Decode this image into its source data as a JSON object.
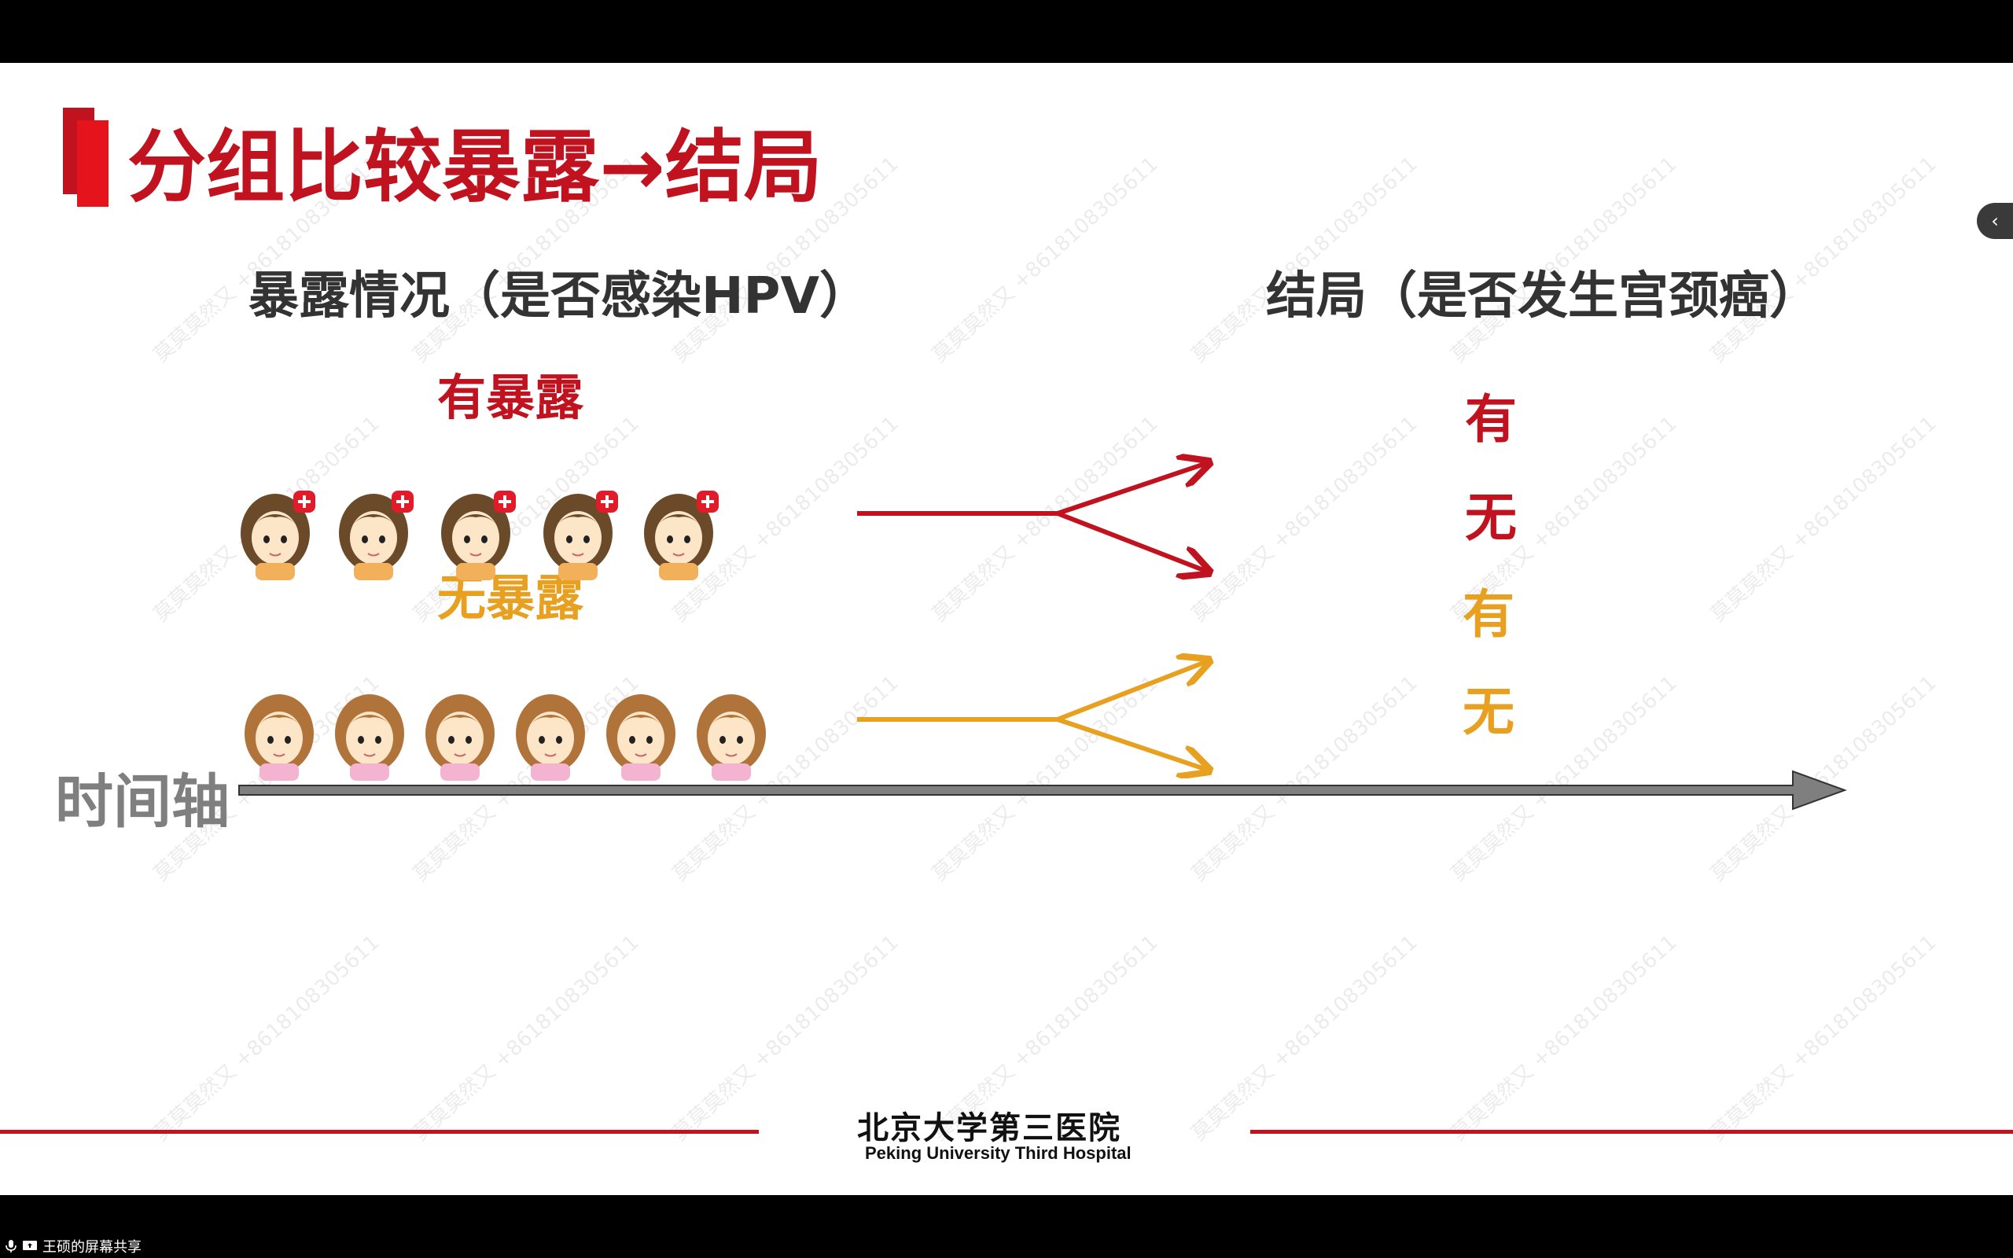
{
  "slide": {
    "title": "分组比较暴露→结局",
    "exposure_header": "暴露情况（是否感染HPV）",
    "outcome_header": "结局（是否发生宫颈癌）",
    "exposed_label": "有暴露",
    "unexposed_label": "无暴露",
    "outcomes": [
      "有",
      "无",
      "有",
      "无"
    ],
    "timeline_label": "时间轴",
    "watermark": "莫莫莫然又 +8618108305611",
    "colors": {
      "title": "#c1121f",
      "exposed": "#c1121f",
      "unexposed": "#e8a020",
      "timeline": "#7f7f7f"
    }
  },
  "footer": {
    "hospital_cn": "北京大学第三医院",
    "hospital_en": "Peking University Third Hospital"
  },
  "status": {
    "share_text": "王硕的屏幕共享",
    "icons": [
      "microphone-icon",
      "screen-share-icon",
      "chevron-left-icon"
    ]
  }
}
